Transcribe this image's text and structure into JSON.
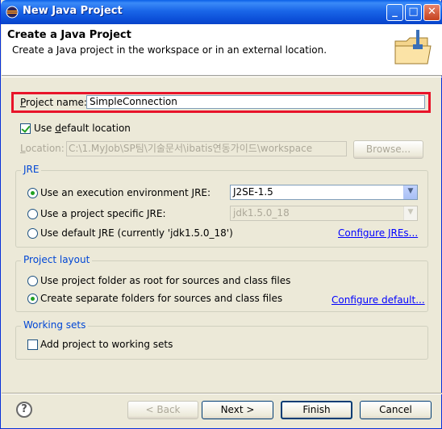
{
  "window": {
    "title": "New Java Project",
    "controls": {
      "minimize": "_",
      "maximize": "□",
      "close": "✕"
    }
  },
  "header": {
    "title": "Create a Java Project",
    "description": "Create a Java project in the workspace or in an external location."
  },
  "project": {
    "name_label_mnemonic": "P",
    "name_label_rest": "roject name:",
    "name_value": "SimpleConnection"
  },
  "location": {
    "use_default_pre": "Use ",
    "use_default_mnemonic": "d",
    "use_default_rest": "efault location",
    "use_default_checked": true,
    "label_mnemonic": "L",
    "label_rest": "ocation:",
    "path": "C:\\1.MyJob\\SP팀\\기술문서\\ibatis연동가이드\\workspace",
    "browse_label": "Browse..."
  },
  "jre": {
    "group_title": "JRE",
    "exec_env_label": "Use an execution environment JRE:",
    "exec_env_value": "J2SE-1.5",
    "specific_label": "Use a project specific JRE:",
    "specific_value": "jdk1.5.0_18",
    "default_label": "Use default JRE (currently 'jdk1.5.0_18')",
    "configure_link": "Configure JREs...",
    "selected": "exec_env"
  },
  "layout": {
    "group_title": "Project layout",
    "option_root": "Use project folder as root for sources and class files",
    "option_separate": "Create separate folders for sources and class files",
    "configure_link": "Configure default...",
    "selected": "separate"
  },
  "working_sets": {
    "group_title": "Working sets",
    "add_label": "Add project to working sets",
    "checked": false
  },
  "buttons": {
    "help": "?",
    "back": "< Back",
    "next": "Next >",
    "finish": "Finish",
    "cancel": "Cancel"
  },
  "colors": {
    "title_bar": "#0a5fe6",
    "highlight_border": "#e8142a",
    "link": "#0000ff",
    "group_title": "#0046d5"
  }
}
